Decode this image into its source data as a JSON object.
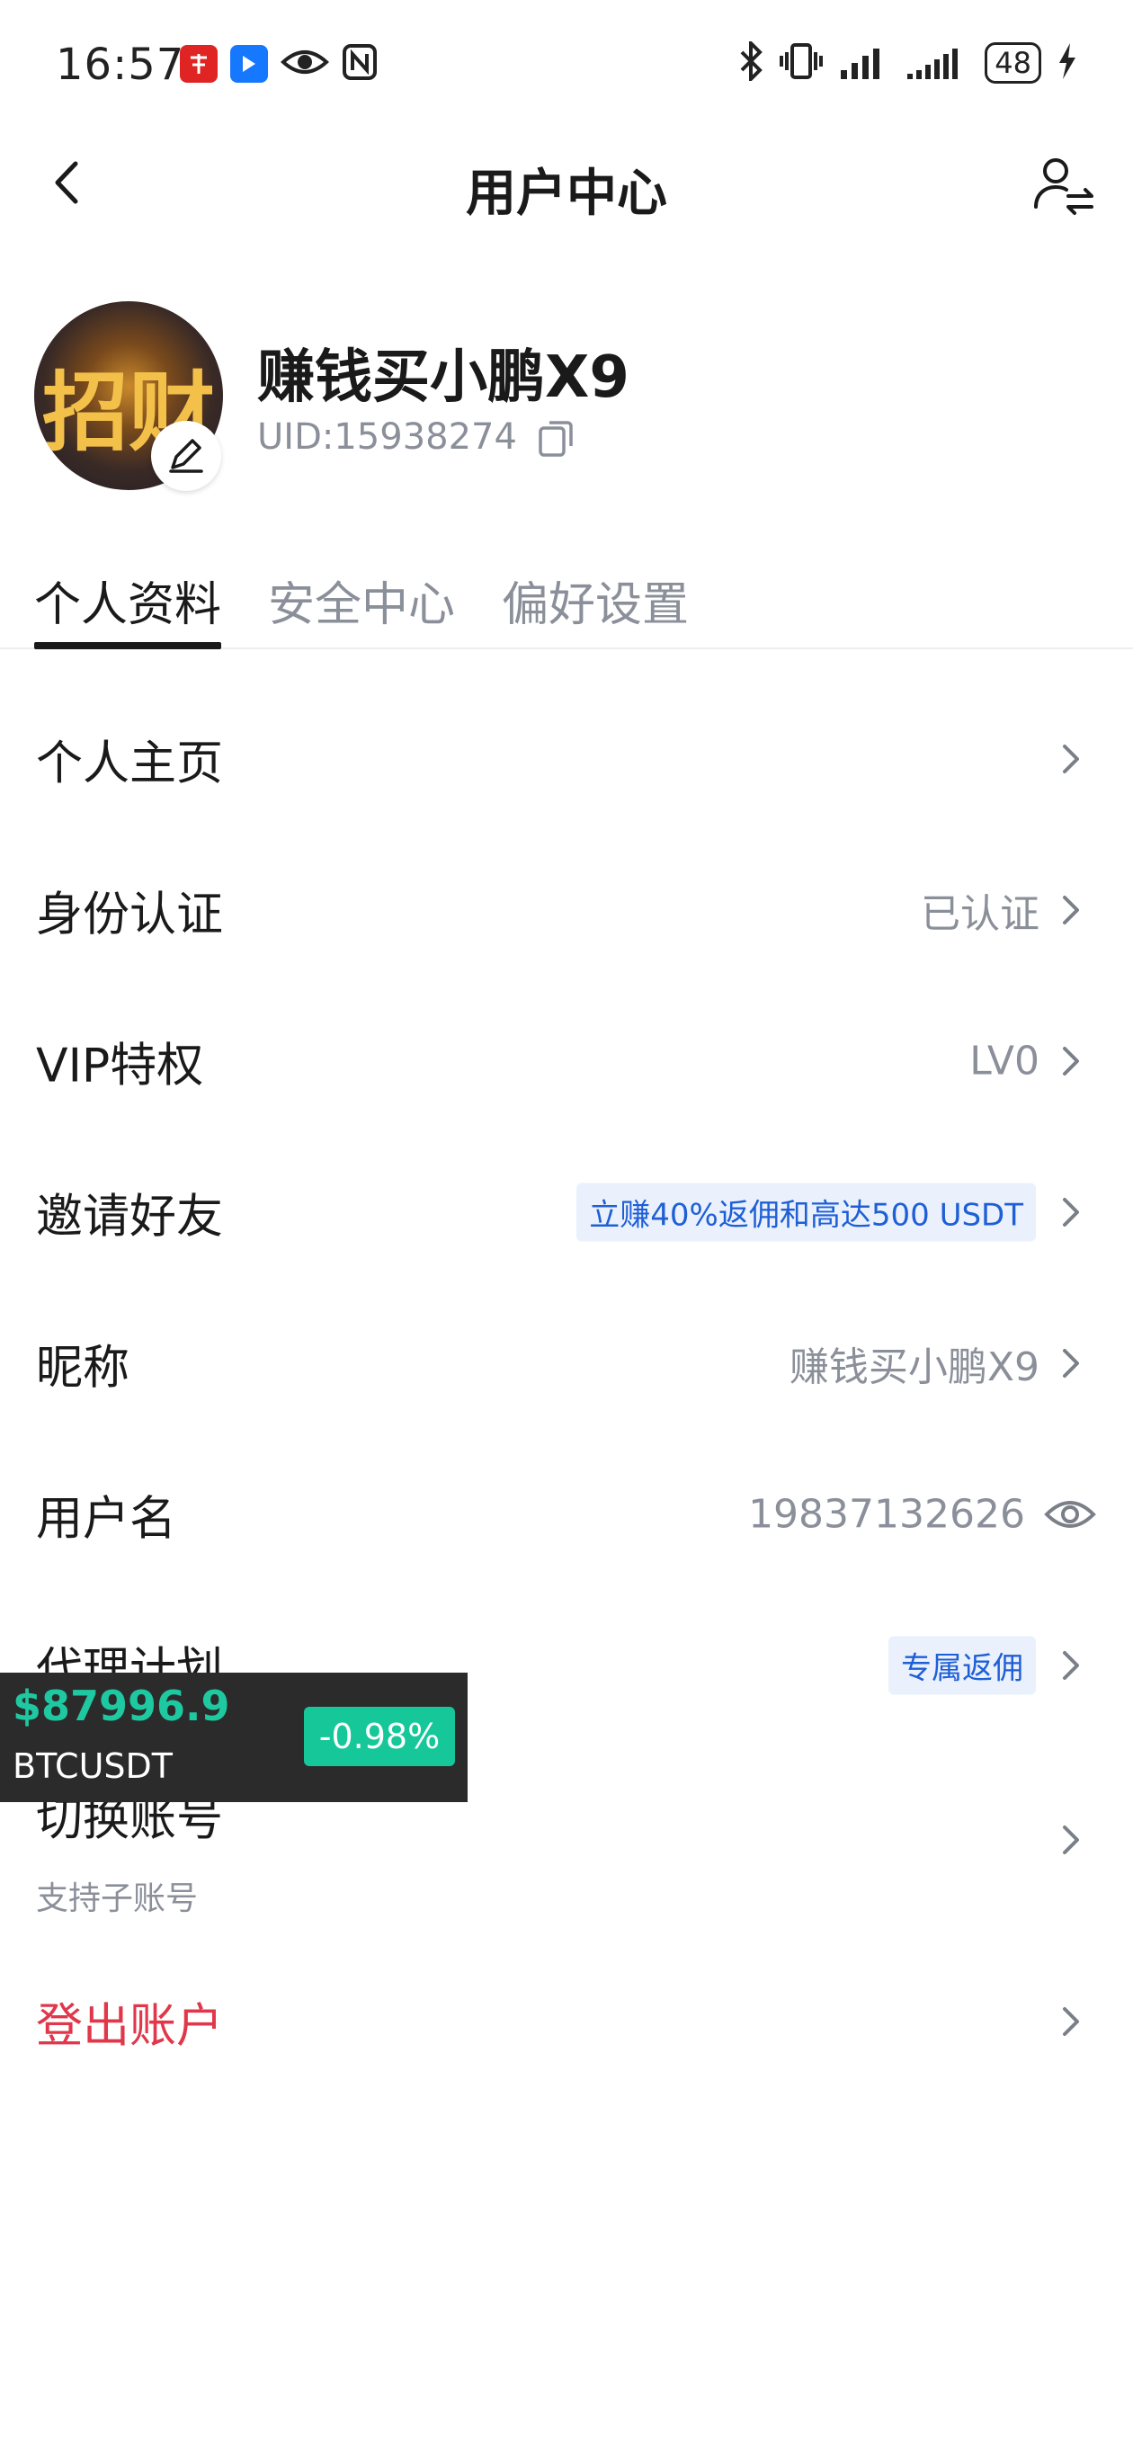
{
  "status_bar": {
    "time": "16:57",
    "battery": "48",
    "app_icons": [
      "app-red-icon",
      "app-blue-icon",
      "eye-icon",
      "nfc-icon"
    ],
    "system_icons": [
      "bluetooth-icon",
      "vibrate-icon",
      "signal-icon",
      "signal-icon",
      "battery-icon",
      "charging-icon"
    ]
  },
  "header": {
    "title": "用户中心"
  },
  "profile": {
    "nickname": "赚钱买小鹏X9",
    "uid": "UID:15938274",
    "avatar_glyph": "招财"
  },
  "tabs": [
    {
      "label": "个人资料",
      "active": true
    },
    {
      "label": "安全中心",
      "active": false
    },
    {
      "label": "偏好设置",
      "active": false
    }
  ],
  "rows": {
    "homepage": {
      "label": "个人主页"
    },
    "identity": {
      "label": "身份认证",
      "value": "已认证"
    },
    "vip": {
      "label": "VIP特权",
      "value": "LV0"
    },
    "invite": {
      "label": "邀请好友",
      "chip": "立赚40%返佣和高达500 USDT"
    },
    "nickname": {
      "label": "昵称",
      "value": "赚钱买小鹏X9"
    },
    "username": {
      "label": "用户名",
      "value": "19837132626"
    },
    "agent": {
      "label": "代理计划",
      "chip": "专属返佣"
    },
    "switch_account": {
      "label": "切换账号",
      "sub": "支持子账号"
    },
    "logout": {
      "label": "登出账户"
    }
  },
  "ticker": {
    "price": "$87996.9",
    "symbol": "BTCUSDT",
    "change": "-0.98%"
  },
  "colors": {
    "accent_green": "#16c79a",
    "danger_red": "#e0374a",
    "chip_blue": "#1f5fd6"
  }
}
